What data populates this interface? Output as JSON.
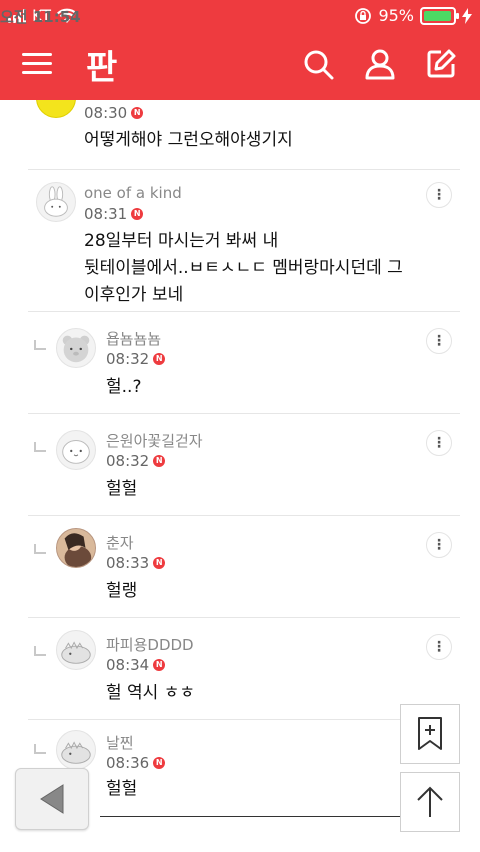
{
  "status": {
    "carrier": "KT",
    "time": "오전 11:54",
    "battery": "95%",
    "battery_level": 0.95
  },
  "app": {
    "logo": "판"
  },
  "comments": [
    {
      "nick": "",
      "time": "08:30",
      "text": "어떻게해야 그런오해야생기지",
      "avatar": "yellow"
    },
    {
      "nick": "one of a kind",
      "time": "08:31",
      "text_lines": [
        "28일부터 마시는거 봐써 내",
        "뒷테이블에서..ㅂㅌㅅㄴㄷ 멤버랑마시던데 그",
        "이후인가 보네"
      ],
      "avatar": "rabbit"
    },
    {
      "nick": "욥뇸뇸뇸",
      "time": "08:32",
      "text": "헐..?",
      "avatar": "bear"
    },
    {
      "nick": "은원아꽃길걷자",
      "time": "08:32",
      "text": "헐헐",
      "avatar": "blob"
    },
    {
      "nick": "춘자",
      "time": "08:33",
      "text": "헐랭",
      "avatar": "photo"
    },
    {
      "nick": "파피용DDDD",
      "time": "08:34",
      "text": "헐 역시 ㅎㅎ",
      "avatar": "dino"
    },
    {
      "nick": "날찐",
      "time": "08:36",
      "text": "헐헐",
      "avatar": "dino"
    }
  ],
  "badge_letter": "N",
  "more_symbol": "⋮",
  "colors": {
    "brand": "#ee3b3f",
    "badge": "#ee3b3f"
  }
}
